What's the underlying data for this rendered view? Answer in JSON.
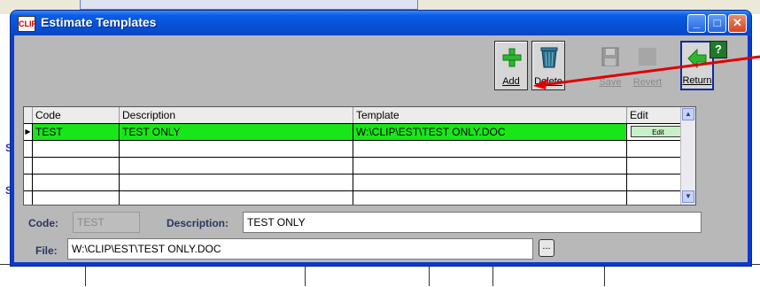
{
  "window": {
    "title": "Estimate Templates",
    "app_icon_text": "CLIP"
  },
  "toolbar": {
    "add_label": "Add",
    "delete_label": "Delete",
    "save_label": "Save",
    "revert_label": "Revert",
    "return_label": "Return",
    "help_label": "?"
  },
  "grid": {
    "columns": [
      "Code",
      "Description",
      "Template",
      "Edit"
    ],
    "rows": [
      {
        "code": "TEST",
        "description": "TEST ONLY",
        "template": "W:\\CLIP\\EST\\TEST ONLY.DOC",
        "edit_label": "Edit"
      }
    ]
  },
  "form": {
    "code_label": "Code:",
    "code_value": "TEST",
    "description_label": "Description:",
    "description_value": "TEST ONLY",
    "file_label": "File:",
    "file_value": "W:\\CLIP\\EST\\TEST ONLY.DOC",
    "browse_label": "..."
  },
  "colors": {
    "titlebar": "#0552d8",
    "selected_row": "#19e619",
    "client_bg": "#b8b8b8",
    "annotation_arrow": "#e00000"
  }
}
